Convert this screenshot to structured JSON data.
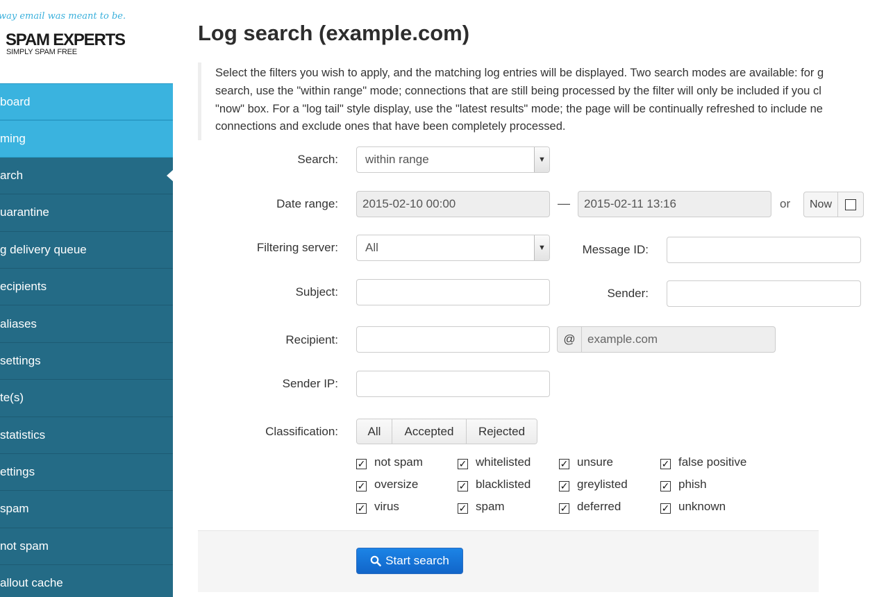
{
  "brand": {
    "tagline": "way email was meant to be.",
    "name": "SPAM EXPERTS",
    "slogan": "SIMPLY SPAM FREE"
  },
  "sidebar": {
    "items": [
      {
        "label": "board",
        "style": "light"
      },
      {
        "label": "ming",
        "style": "light"
      },
      {
        "label": "arch",
        "style": "dark",
        "active": true
      },
      {
        "label": "uarantine",
        "style": "dark"
      },
      {
        "label": "g delivery queue",
        "style": "dark"
      },
      {
        "label": "ecipients",
        "style": "dark"
      },
      {
        "label": " aliases",
        "style": "dark"
      },
      {
        "label": " settings",
        "style": "dark"
      },
      {
        "label": "te(s)",
        "style": "dark"
      },
      {
        "label": " statistics",
        "style": "dark"
      },
      {
        "label": "ettings",
        "style": "dark"
      },
      {
        "label": "spam",
        "style": "dark"
      },
      {
        "label": "not spam",
        "style": "dark"
      },
      {
        "label": "allout cache",
        "style": "dark"
      }
    ]
  },
  "page": {
    "title": "Log search (example.com)",
    "description": [
      "Select the filters you wish to apply, and the matching log entries will be displayed. Two search modes are available: for g",
      "search, use the \"within range\" mode; connections that are still being processed by the filter will only be included if you cl",
      "\"now\" box. For a \"log tail\" style display, use the \"latest results\" mode; the page will be continually refreshed to include ne",
      "connections and exclude ones that have been completely processed."
    ]
  },
  "form": {
    "search_label": "Search:",
    "search_value": "within range",
    "date_label": "Date range:",
    "date_from": "2015-02-10 00:00",
    "date_sep": "—",
    "date_to": "2015-02-11 13:16",
    "or_text": "or",
    "now_label": "Now",
    "server_label": "Filtering server:",
    "server_value": "All",
    "message_id_label": "Message ID:",
    "message_id_value": "",
    "subject_label": "Subject:",
    "subject_value": "",
    "sender_label": "Sender:",
    "sender_value": "",
    "recipient_label": "Recipient:",
    "recipient_value": "",
    "at_symbol": "@",
    "recipient_domain": "example.com",
    "sender_ip_label": "Sender IP:",
    "sender_ip_value": "",
    "classification_label": "Classification:",
    "classification_buttons": [
      "All",
      "Accepted",
      "Rejected"
    ],
    "checkboxes": [
      [
        "not spam",
        "whitelisted",
        "unsure",
        "false positive"
      ],
      [
        "oversize",
        "blacklisted",
        "greylisted",
        "phish"
      ],
      [
        "virus",
        "spam",
        "deferred",
        "unknown"
      ]
    ],
    "submit_label": "Start search"
  }
}
